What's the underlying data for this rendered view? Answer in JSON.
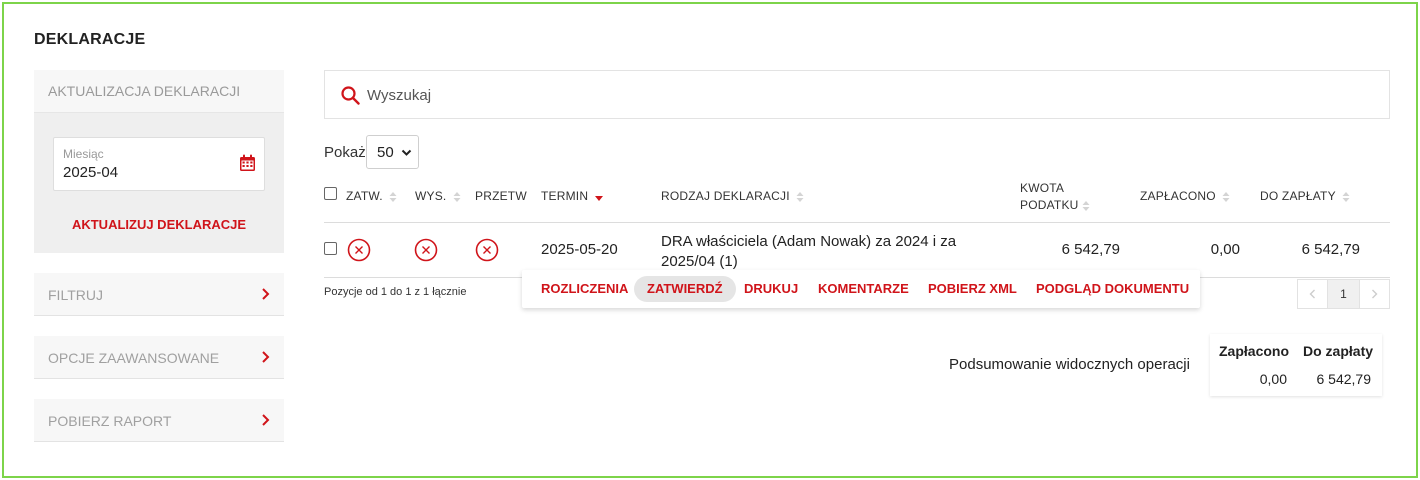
{
  "page": {
    "title": "DEKLARACJE"
  },
  "sidebar": {
    "update_panel": {
      "heading": "AKTUALIZACJA DEKLARACJI",
      "month_label": "Miesiąc",
      "month_value": "2025-04",
      "update_button": "AKTUALIZUJ DEKLARACJE"
    },
    "items": [
      {
        "label": "FILTRUJ"
      },
      {
        "label": "OPCJE ZAAWANSOWANE"
      },
      {
        "label": "POBIERZ RAPORT"
      }
    ]
  },
  "search": {
    "placeholder": "Wyszukaj"
  },
  "page_size": {
    "label": "Pokaż",
    "selected": "50"
  },
  "table": {
    "headers": {
      "approved": "ZATW.",
      "sent": "WYS.",
      "processed": "PRZETW",
      "deadline": "TERMIN",
      "type": "RODZAJ DEKLARACJI",
      "tax_amount_line1": "KWOTA",
      "tax_amount_line2": "PODATKU",
      "paid": "ZAPŁACONO",
      "to_pay": "DO ZAPŁATY"
    },
    "rows": [
      {
        "deadline": "2025-05-20",
        "type": "DRA właściciela (Adam Nowak) za 2024 i za 2025/04 (1)",
        "tax_amount": "6 542,79",
        "paid": "0,00",
        "to_pay": "6 542,79"
      }
    ],
    "positions_text": "Pozycje od 1 do 1 z 1 łącznie"
  },
  "row_actions": [
    {
      "label": "ROZLICZENIA"
    },
    {
      "label": "ZATWIERDŹ"
    },
    {
      "label": "DRUKUJ"
    },
    {
      "label": "KOMENTARZE"
    },
    {
      "label": "POBIERZ XML"
    },
    {
      "label": "PODGLĄD DOKUMENTU"
    }
  ],
  "pagination": {
    "current": "1"
  },
  "summary": {
    "label": "Podsumowanie widocznych operacji",
    "paid_header": "Zapłacono",
    "to_pay_header": "Do zapłaty",
    "paid_value": "0,00",
    "to_pay_value": "6 542,79"
  },
  "colors": {
    "accent": "#d0141a",
    "frame": "#7dd44a",
    "panel_bg": "#efefef"
  }
}
